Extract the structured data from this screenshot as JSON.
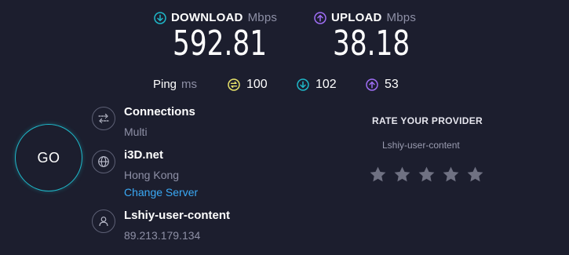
{
  "download": {
    "label": "DOWNLOAD",
    "unit": "Mbps",
    "value": "592.81",
    "color": "#1fb8c9"
  },
  "upload": {
    "label": "UPLOAD",
    "unit": "Mbps",
    "value": "38.18",
    "color": "#9f6ef5"
  },
  "ping": {
    "label": "Ping",
    "unit": "ms",
    "idle": "100",
    "download": "102",
    "upload": "53",
    "idle_color": "#e8e36a"
  },
  "go_button": {
    "label": "GO"
  },
  "connections": {
    "title": "Connections",
    "value": "Multi"
  },
  "server": {
    "name": "i3D.net",
    "location": "Hong Kong",
    "change_link": "Change Server"
  },
  "user": {
    "name": "Lshiy-user-content",
    "ip": "89.213.179.134"
  },
  "rate": {
    "title": "RATE YOUR PROVIDER",
    "provider": "Lshiy-user-content",
    "stars_total": 5,
    "stars_selected": 0
  }
}
